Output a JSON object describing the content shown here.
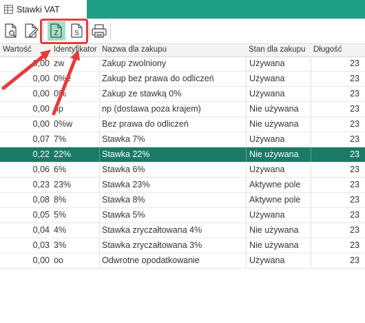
{
  "tab": {
    "title": "Stawki VAT"
  },
  "toolbar": {
    "buttons": [
      "preview-icon",
      "edit-icon",
      "document-z-icon",
      "document-s-icon",
      "print-icon"
    ],
    "labels": {
      "z": "Z",
      "s": "S"
    }
  },
  "table": {
    "columns": [
      "Wartość",
      "Identyfikator",
      "Nazwa dla zakupu",
      "Stan dla zakupu",
      "Długość"
    ],
    "rows": [
      [
        "0,00",
        "zw",
        "Zakup zwolniony",
        "Używana",
        "23"
      ],
      [
        "0,00",
        "0%e",
        "Zakup bez prawa do odliczeń",
        "Używana",
        "23"
      ],
      [
        "0,00",
        "0%",
        "Zakup ze stawką 0%",
        "Używana",
        "23"
      ],
      [
        "0,00",
        "np",
        "np (dostawa poza krajem)",
        "Nie używana",
        "23"
      ],
      [
        "0,00",
        "0%w",
        "Bez prawa do odliczeń",
        "Nie używana",
        "23"
      ],
      [
        "0,07",
        "7%",
        "Stawka 7%",
        "Używana",
        "23"
      ],
      [
        "0,22",
        "22%",
        "Stawka 22%",
        "Nie używana",
        "23"
      ],
      [
        "0,06",
        "6%",
        "Stawka 6%",
        "Używana",
        "23"
      ],
      [
        "0,23",
        "23%",
        "Stawka 23%",
        "Aktywne pole",
        "23"
      ],
      [
        "0,08",
        "8%",
        "Stawka 8%",
        "Aktywne pole",
        "23"
      ],
      [
        "0,05",
        "5%",
        "Stawka 5%",
        "Używana",
        "23"
      ],
      [
        "0,04",
        "4%",
        "Stawka zryczałtowana 4%",
        "Nie używana",
        "23"
      ],
      [
        "0,03",
        "3%",
        "Stawka zryczałtowana 3%",
        "Nie używana",
        "23"
      ],
      [
        "0,00",
        "oo",
        "Odwrotne opodatkowanie",
        "Używana",
        "23"
      ]
    ],
    "selected_index": 6
  },
  "colors": {
    "title_bar": "#1f9f86",
    "selected_row": "#1a7a65",
    "active_button": "#9fe0c6",
    "highlight": "#e53b3b"
  }
}
